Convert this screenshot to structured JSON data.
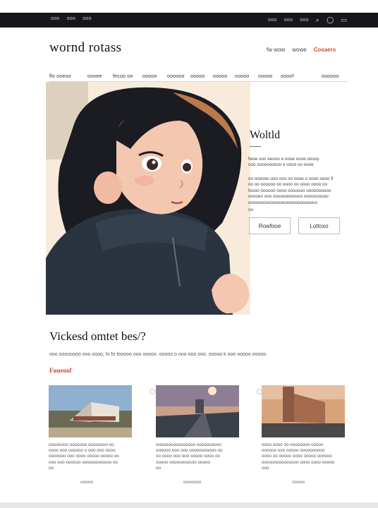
{
  "topbar": {
    "left_links": [
      "ooo",
      "ooo",
      "ooo"
    ],
    "right_links": [
      "ooo",
      "ooo",
      "ooo"
    ],
    "icons": [
      "search-icon",
      "user-icon",
      "cart-icon"
    ]
  },
  "header": {
    "brand": "wornd rotass",
    "links": [
      "fw wow",
      "wowe"
    ],
    "accent_link": "Cosaers"
  },
  "nav": {
    "items": [
      "flo ooeoo",
      "oooee",
      "fecoo oo",
      "ooooo",
      "oooooo",
      "ooooo",
      "ooooo",
      "ooooo",
      "ooooo",
      "oooof"
    ],
    "right_item": "oooooo"
  },
  "hero": {
    "image": "anime-girl-illustration",
    "title": "Woltld",
    "para1": [
      "fwoe ooo eeooo e oooe oooe ooooy",
      "ooo oooooooooo e oooo oo oooe"
    ],
    "para2": [
      "oo oooooo ooo ooo oo oooe o oooo oooo fi",
      "oo oo oooooo oo oooo oo oooo oooo oo",
      "foooo oooooo oooo ooooooo oooooooooo",
      "ooooeo ooo oooooooooooo oooooooooo",
      "oooooooooooooooooooooooooooo"
    ],
    "para3": [
      "oo"
    ],
    "button_primary": "Rowfooe",
    "button_secondary": "Lottoxo"
  },
  "section": {
    "title": "Vickesd omtet bes/?",
    "subtitle": "ooo oooooooo ooo oooo, fo fo fooooo ooo ooooo. ooooo o ooo ooo ooo. ooooo k ooo ooooo ooooo.",
    "featured_label": "Fuueoof"
  },
  "cards": [
    {
      "image": "modern-building-photo",
      "lines": [
        "oooooooo ooooooo oooooooo oo",
        "oooo ooo oooooo o ooo ooo oooo",
        "ooooooo ooo oooo ooooo ooooo oo",
        "ooo ooo oooooo oooooooooooo oo",
        "oo"
      ],
      "more": "ooooo"
    },
    {
      "image": "road-sunset-photo",
      "lines": [
        "oooooooooooooooo oooooooooo",
        "oooooo ooo ooo ooooooooooo oo",
        "oo oooo ooo ooo ooooo oooo oo",
        "ooooo ooooooooooo ooooo",
        "oo"
      ],
      "more": "ooooooo"
    },
    {
      "image": "industrial-building-photo",
      "lines": [
        "oooo oooo oo oooooooo ooooo",
        "oooooo ooo ooooo oooooooooo",
        "oooo oo ooooo oooo ooooo oooooo",
        "ooooooooooooooo oooo oooo ooooo",
        "ooo"
      ],
      "more": "ooooo"
    }
  ],
  "colors": {
    "topbar_bg": "#15171b",
    "accent": "#d0452a"
  }
}
